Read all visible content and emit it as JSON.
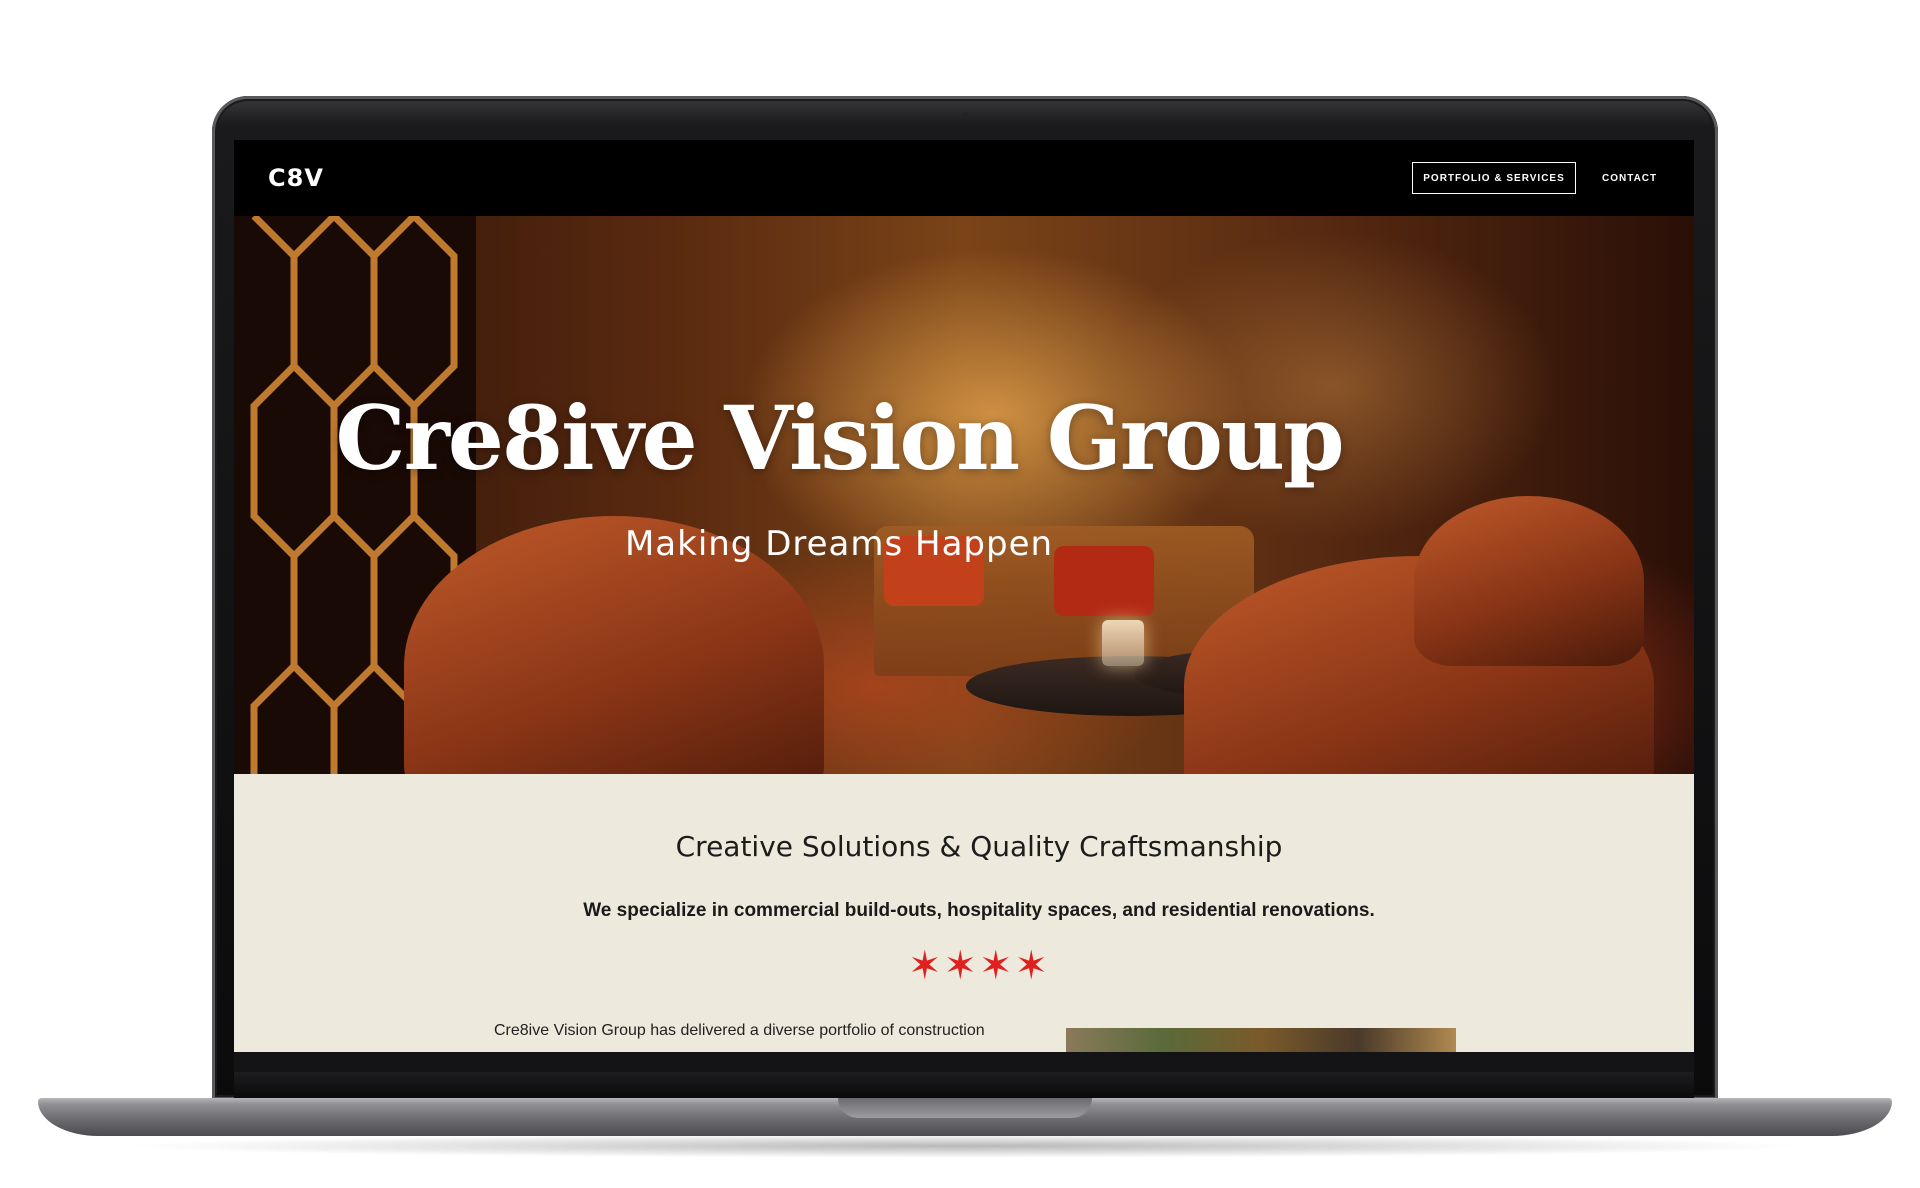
{
  "nav": {
    "logo": "C8V",
    "portfolio_label": "PORTFOLIO & SERVICES",
    "contact_label": "CONTACT"
  },
  "hero": {
    "title": "Cre8ive Vision Group",
    "subtitle": "Making Dreams Happen"
  },
  "intro": {
    "heading": "Creative Solutions & Quality Craftsmanship",
    "lead": "We specialize in commercial build-outs, hospitality spaces, and residential renovations.",
    "stars": "✶✶✶✶",
    "body": "Cre8ive Vision Group has delivered a diverse portfolio of construction"
  },
  "colors": {
    "nav_bg": "#000000",
    "content_bg": "#ede9dc",
    "star_red": "#e0201e"
  }
}
